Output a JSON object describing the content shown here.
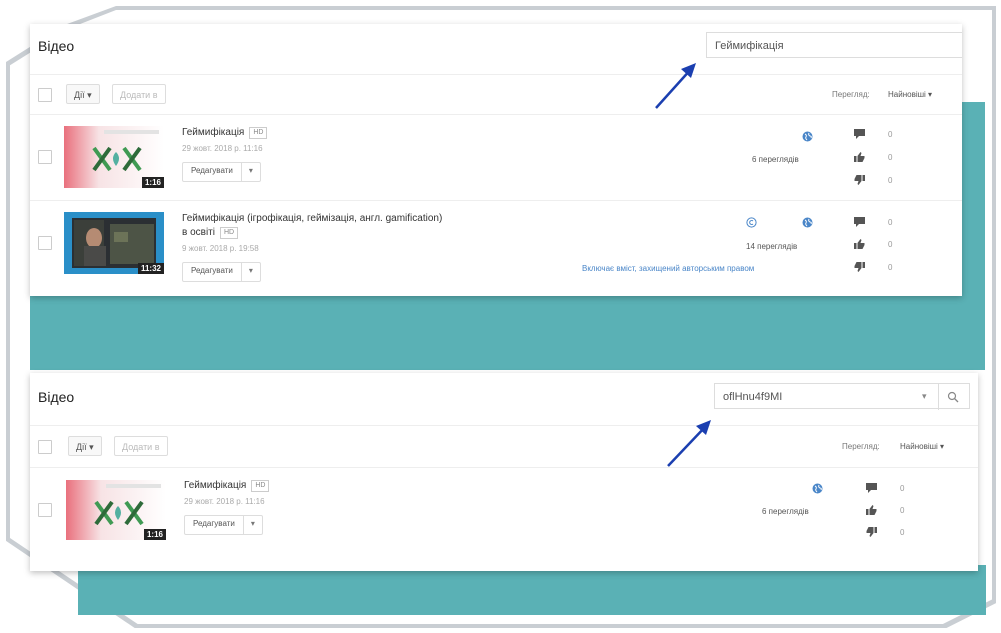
{
  "colors": {
    "teal": "#5ab1b5",
    "link_blue": "#4a86c8",
    "arrow_blue": "#1b3fb0"
  },
  "panel_top": {
    "title": "Відео",
    "search_value": "Геймифікація",
    "actions_label": "Дії",
    "add_to_label": "Додати в",
    "sort_label": "Перегляд:",
    "sort_value": "Найновіші",
    "videos": [
      {
        "title": "Геймифікація",
        "badge": "HD",
        "date": "29 жовт. 2018 р. 11:16",
        "duration": "1:16",
        "edit_label": "Редагувати",
        "views": "6 переглядів",
        "comments": "0",
        "likes": "0",
        "dislikes": "0"
      },
      {
        "title_line1": "Геймифікація (ігрофікація, геймізація, англ. gamification)",
        "title_line2": "в освіті",
        "badge": "HD",
        "date": "9 жовт. 2018 р. 19:58",
        "duration": "11:32",
        "edit_label": "Редагувати",
        "views": "14 переглядів",
        "copyright_note": "Включає вміст, захищений авторським правом",
        "comments": "0",
        "likes": "0",
        "dislikes": "0"
      }
    ]
  },
  "panel_bottom": {
    "title": "Відео",
    "search_value": "oflHnu4f9MI",
    "actions_label": "Дії",
    "add_to_label": "Додати в",
    "sort_label": "Перегляд:",
    "sort_value": "Найновіші",
    "videos": [
      {
        "title": "Геймифікація",
        "badge": "HD",
        "date": "29 жовт. 2018 р. 11:16",
        "duration": "1:16",
        "edit_label": "Редагувати",
        "views": "6 переглядів",
        "comments": "0",
        "likes": "0",
        "dislikes": "0"
      }
    ]
  }
}
